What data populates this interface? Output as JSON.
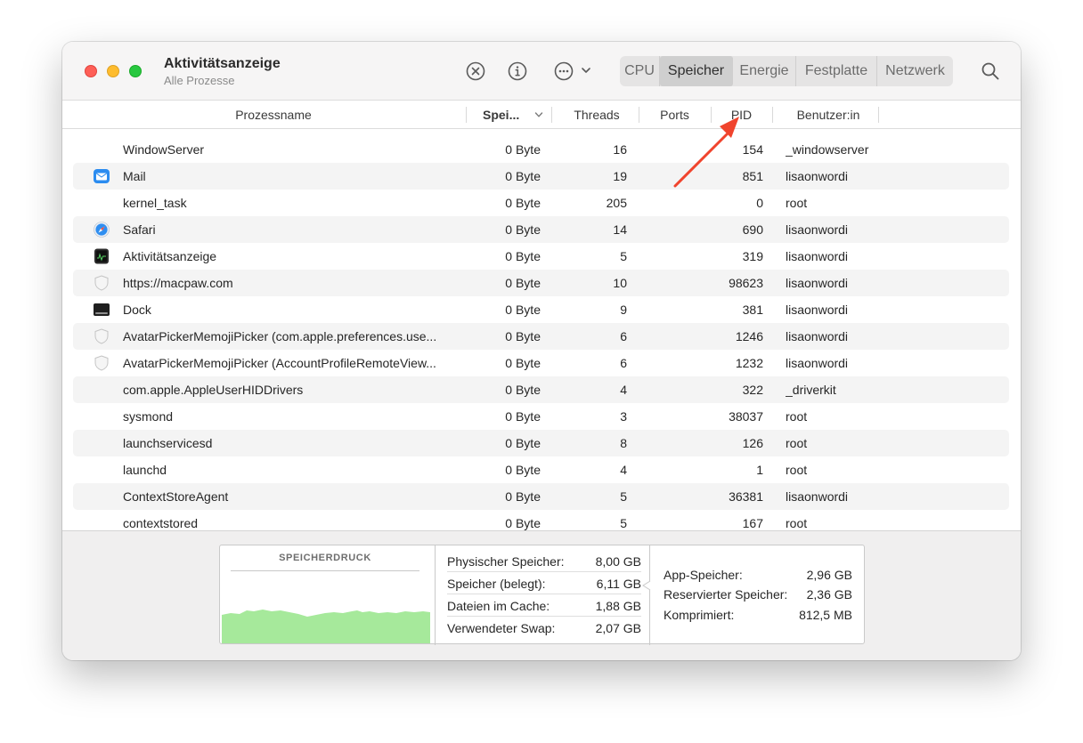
{
  "window": {
    "title": "Aktivitätsanzeige",
    "subtitle": "Alle Prozesse"
  },
  "toolbar": {
    "icons": [
      "stop-process-icon",
      "info-icon",
      "more-actions-icon",
      "chevron-down-icon",
      "search-icon"
    ],
    "tabs": [
      {
        "label": "CPU",
        "active": false
      },
      {
        "label": "Speicher",
        "active": true
      },
      {
        "label": "Energie",
        "active": false
      },
      {
        "label": "Festplatte",
        "active": false
      },
      {
        "label": "Netzwerk",
        "active": false
      }
    ]
  },
  "columns": {
    "name": "Prozessname",
    "memory": "Spei...",
    "threads": "Threads",
    "ports": "Ports",
    "pid": "PID",
    "user": "Benutzer:in"
  },
  "processes": [
    {
      "name": "WindowServer",
      "icon": "",
      "memory": "0 Byte",
      "threads": "16",
      "pid": "154",
      "user": "_windowserver"
    },
    {
      "name": "Mail",
      "icon": "mail-app-icon",
      "memory": "0 Byte",
      "threads": "19",
      "pid": "851",
      "user": "lisaonwordi"
    },
    {
      "name": "kernel_task",
      "icon": "",
      "memory": "0 Byte",
      "threads": "205",
      "pid": "0",
      "user": "root"
    },
    {
      "name": "Safari",
      "icon": "safari-app-icon",
      "memory": "0 Byte",
      "threads": "14",
      "pid": "690",
      "user": "lisaonwordi"
    },
    {
      "name": "Aktivitätsanzeige",
      "icon": "activity-monitor-app-icon",
      "memory": "0 Byte",
      "threads": "5",
      "pid": "319",
      "user": "lisaonwordi"
    },
    {
      "name": "https://macpaw.com",
      "icon": "shield-icon",
      "memory": "0 Byte",
      "threads": "10",
      "pid": "98623",
      "user": "lisaonwordi"
    },
    {
      "name": "Dock",
      "icon": "dock-app-icon",
      "memory": "0 Byte",
      "threads": "9",
      "pid": "381",
      "user": "lisaonwordi"
    },
    {
      "name": "AvatarPickerMemojiPicker (com.apple.preferences.use...",
      "icon": "shield-icon",
      "memory": "0 Byte",
      "threads": "6",
      "pid": "1246",
      "user": "lisaonwordi"
    },
    {
      "name": "AvatarPickerMemojiPicker (AccountProfileRemoteView...",
      "icon": "shield-icon",
      "memory": "0 Byte",
      "threads": "6",
      "pid": "1232",
      "user": "lisaonwordi"
    },
    {
      "name": "com.apple.AppleUserHIDDrivers",
      "icon": "",
      "memory": "0 Byte",
      "threads": "4",
      "pid": "322",
      "user": "_driverkit"
    },
    {
      "name": "sysmond",
      "icon": "",
      "memory": "0 Byte",
      "threads": "3",
      "pid": "38037",
      "user": "root"
    },
    {
      "name": "launchservicesd",
      "icon": "",
      "memory": "0 Byte",
      "threads": "8",
      "pid": "126",
      "user": "root"
    },
    {
      "name": "launchd",
      "icon": "",
      "memory": "0 Byte",
      "threads": "4",
      "pid": "1",
      "user": "root"
    },
    {
      "name": "ContextStoreAgent",
      "icon": "",
      "memory": "0 Byte",
      "threads": "5",
      "pid": "36381",
      "user": "lisaonwordi"
    },
    {
      "name": "contextstored",
      "icon": "",
      "memory": "0 Byte",
      "threads": "5",
      "pid": "167",
      "user": "root"
    }
  ],
  "summary": {
    "pressure_title": "SPEICHERDRUCK",
    "pressure_color": "#a6e99b",
    "left_stats": [
      {
        "label": "Physischer Speicher:",
        "value": "8,00 GB"
      },
      {
        "label": "Speicher (belegt):",
        "value": "6,11 GB"
      },
      {
        "label": "Dateien im Cache:",
        "value": "1,88 GB"
      },
      {
        "label": "Verwendeter Swap:",
        "value": "2,07 GB"
      }
    ],
    "right_stats": [
      {
        "label": "App-Speicher:",
        "value": "2,96 GB"
      },
      {
        "label": "Reservierter Speicher:",
        "value": "2,36 GB"
      },
      {
        "label": "Komprimiert:",
        "value": "812,5 MB"
      }
    ]
  },
  "annotation": {
    "arrow_color": "#f0442d"
  }
}
